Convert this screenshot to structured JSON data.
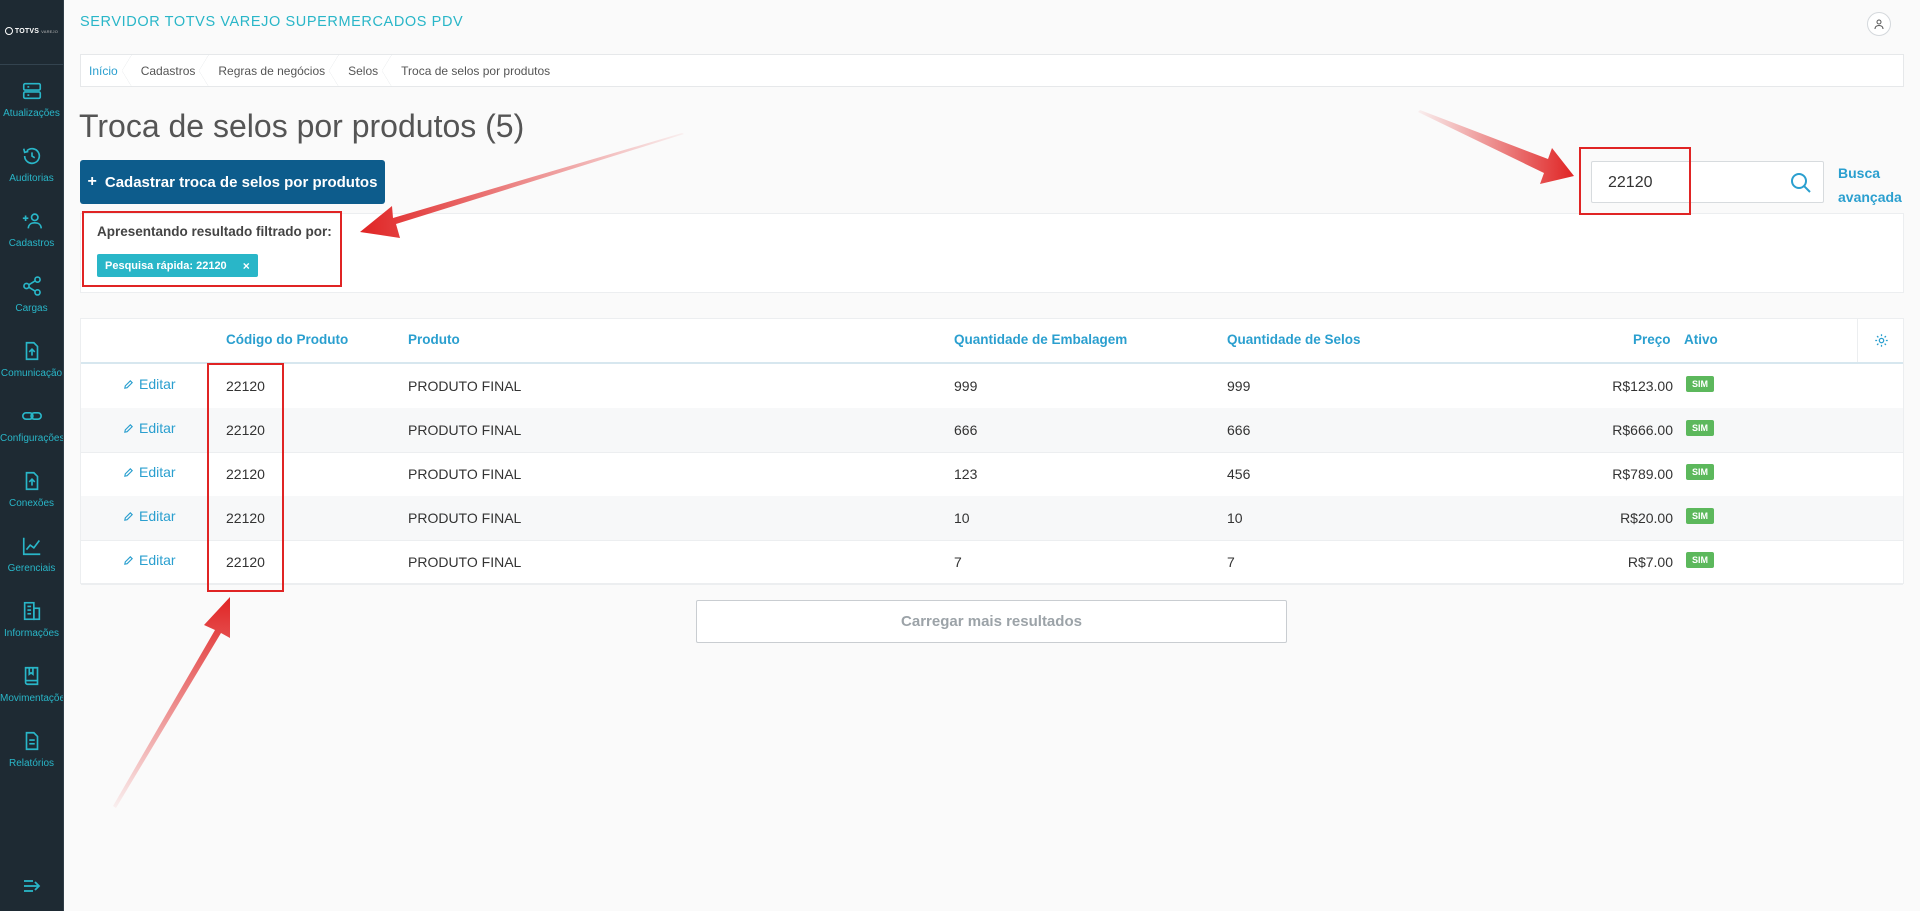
{
  "app": {
    "title": "SERVIDOR TOTVS VAREJO SUPERMERCADOS PDV",
    "logo_text": "TOTVS",
    "logo_sub": "VAREJO"
  },
  "sidebar": {
    "items": [
      {
        "label": "Atualizações",
        "icon": "server-icon"
      },
      {
        "label": "Auditorias",
        "icon": "history-icon"
      },
      {
        "label": "Cadastros",
        "icon": "add-user-icon"
      },
      {
        "label": "Cargas",
        "icon": "share-icon"
      },
      {
        "label": "Comunicação",
        "icon": "file-upload-icon"
      },
      {
        "label": "Configurações",
        "icon": "link-icon"
      },
      {
        "label": "Conexões",
        "icon": "file-upload-icon"
      },
      {
        "label": "Gerenciais",
        "icon": "chart-icon"
      },
      {
        "label": "Informações",
        "icon": "building-icon"
      },
      {
        "label": "Movimentações",
        "icon": "book-icon"
      },
      {
        "label": "Relatórios",
        "icon": "document-icon"
      }
    ]
  },
  "breadcrumb": [
    "Início",
    "Cadastros",
    "Regras de negócios",
    "Selos",
    "Troca de selos por produtos"
  ],
  "page": {
    "title": "Troca de selos por produtos (5)",
    "add_button": "Cadastrar troca de selos por produtos",
    "add_icon": "+"
  },
  "search": {
    "value": "22120",
    "advanced_1": "Busca",
    "advanced_2": "avançada"
  },
  "filter": {
    "text": "Apresentando resultado filtrado por:",
    "tag": "Pesquisa rápida: 22120",
    "tag_close": "×"
  },
  "table": {
    "headers": {
      "code": "Código do Produto",
      "product": "Produto",
      "pack_qty": "Quantidade de Embalagem",
      "seal_qty": "Quantidade de Selos",
      "price": "Preço",
      "active": "Ativo"
    },
    "edit_label": "Editar",
    "rows": [
      {
        "code": "22120",
        "product": "PRODUTO FINAL",
        "pack_qty": "999",
        "seal_qty": "999",
        "price": "R$123.00",
        "active": "SIM"
      },
      {
        "code": "22120",
        "product": "PRODUTO FINAL",
        "pack_qty": "666",
        "seal_qty": "666",
        "price": "R$666.00",
        "active": "SIM"
      },
      {
        "code": "22120",
        "product": "PRODUTO FINAL",
        "pack_qty": "123",
        "seal_qty": "456",
        "price": "R$789.00",
        "active": "SIM"
      },
      {
        "code": "22120",
        "product": "PRODUTO FINAL",
        "pack_qty": "10",
        "seal_qty": "10",
        "price": "R$20.00",
        "active": "SIM"
      },
      {
        "code": "22120",
        "product": "PRODUTO FINAL",
        "pack_qty": "7",
        "seal_qty": "7",
        "price": "R$7.00",
        "active": "SIM"
      }
    ]
  },
  "load_more": "Carregar mais resultados",
  "colors": {
    "accent": "#29b6c8",
    "primary_button": "#0d5c8c",
    "sidebar": "#1e2a33",
    "badge": "#5cb85c",
    "annotation": "#e02424"
  }
}
